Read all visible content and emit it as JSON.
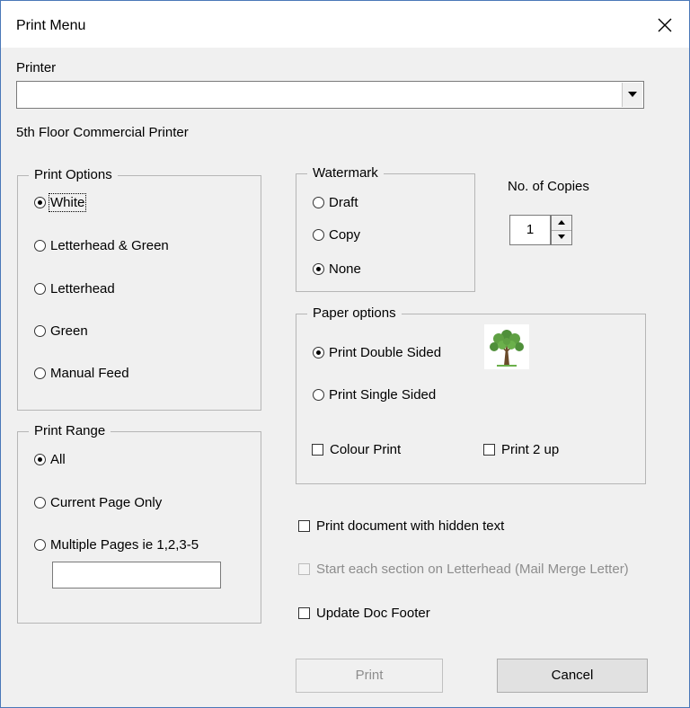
{
  "window": {
    "title": "Print Menu"
  },
  "printer": {
    "label": "Printer",
    "value": "",
    "selected_name": "5th Floor Commercial Printer"
  },
  "print_options": {
    "label": "Print Options",
    "items": [
      {
        "label": "White",
        "selected": true
      },
      {
        "label": "Letterhead & Green",
        "selected": false
      },
      {
        "label": "Letterhead",
        "selected": false
      },
      {
        "label": "Green",
        "selected": false
      },
      {
        "label": "Manual Feed",
        "selected": false
      }
    ]
  },
  "watermark": {
    "label": "Watermark",
    "items": [
      {
        "label": "Draft",
        "selected": false
      },
      {
        "label": "Copy",
        "selected": false
      },
      {
        "label": "None",
        "selected": true
      }
    ]
  },
  "copies": {
    "label": "No. of Copies",
    "value": "1"
  },
  "paper_options": {
    "label": "Paper options",
    "double_sided": "Print Double Sided",
    "single_sided": "Print Single Sided",
    "selected": "double",
    "colour_print": "Colour Print",
    "print_2up": "Print 2 up",
    "icon": "tree-icon"
  },
  "print_range": {
    "label": "Print Range",
    "items": [
      {
        "label": "All",
        "selected": true
      },
      {
        "label": "Current Page Only",
        "selected": false
      },
      {
        "label": "Multiple Pages ie 1,2,3-5",
        "selected": false
      }
    ],
    "pages_value": ""
  },
  "options": {
    "hidden_text": "Print document with hidden text",
    "letterhead_section": "Start each section on Letterhead (Mail Merge Letter)",
    "update_footer": "Update Doc Footer"
  },
  "buttons": {
    "print": "Print",
    "cancel": "Cancel"
  },
  "colors": {
    "window_bg": "#f0f0f0",
    "border": "#4a78b8",
    "disabled_text": "#8d8d8d",
    "group_border": "#b6b6b6"
  }
}
